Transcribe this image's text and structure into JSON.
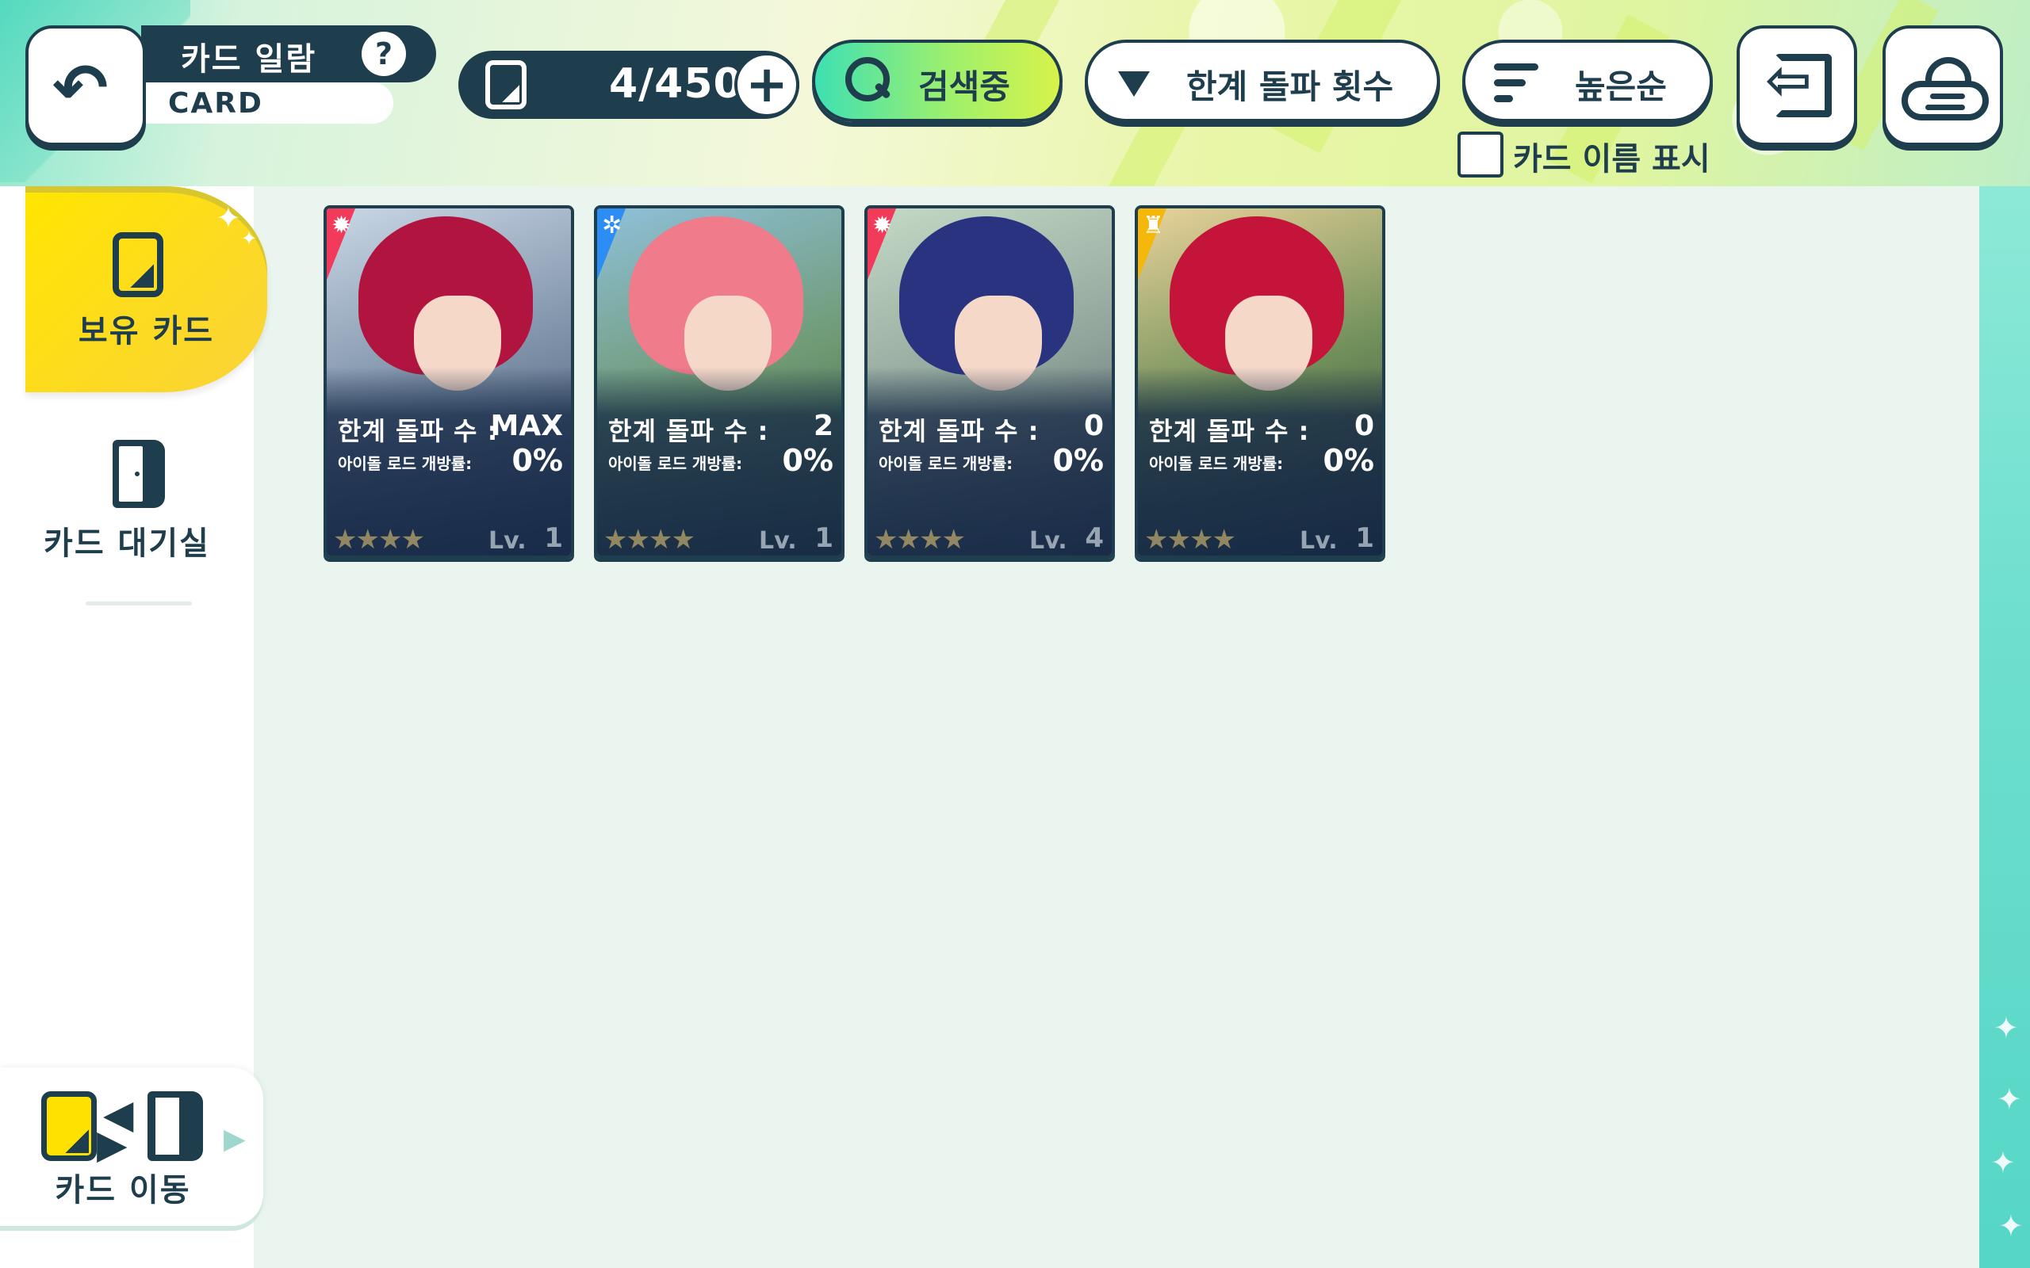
{
  "header": {
    "title": "카드 일람",
    "subtitle": "CARD",
    "help_symbol": "?",
    "card_count": "4/450",
    "search_label": "검색중",
    "filter_label": "한계 돌파 횟수",
    "sort_label": "높은순",
    "show_names_label": "카드 이름 표시"
  },
  "sidebar": {
    "owned_label": "보유 카드",
    "waiting_label": "카드 대기실",
    "move_label": "카드 이동"
  },
  "cards": [
    {
      "attribute": "red",
      "attribute_color": "#f23a5a",
      "limit_break_label": "한계 돌파 수 :",
      "limit_break": "MAX",
      "idol_road_label": "아이돌 로드 개방률:",
      "idol_road": "0%",
      "lv_label": "Lv.",
      "level": "1",
      "stars": "★★★★"
    },
    {
      "attribute": "blue",
      "attribute_color": "#2c8ef5",
      "limit_break_label": "한계 돌파 수 :",
      "limit_break": "2",
      "idol_road_label": "아이돌 로드 개방률:",
      "idol_road": "0%",
      "lv_label": "Lv.",
      "level": "1",
      "stars": "★★★★"
    },
    {
      "attribute": "red",
      "attribute_color": "#f23a5a",
      "limit_break_label": "한계 돌파 수 :",
      "limit_break": "0",
      "idol_road_label": "아이돌 로드 개방률:",
      "idol_road": "0%",
      "lv_label": "Lv.",
      "level": "4",
      "stars": "★★★★"
    },
    {
      "attribute": "yellow",
      "attribute_color": "#f5b70a",
      "limit_break_label": "한계 돌파 수 :",
      "limit_break": "0",
      "idol_road_label": "아이돌 로드 개방률:",
      "idol_road": "0%",
      "lv_label": "Lv.",
      "level": "1",
      "stars": "★★★★"
    }
  ],
  "colors": {
    "navy": "#1e3d4d",
    "accent_yellow": "#ffe600",
    "panel_bg": "#eaf5ef"
  }
}
